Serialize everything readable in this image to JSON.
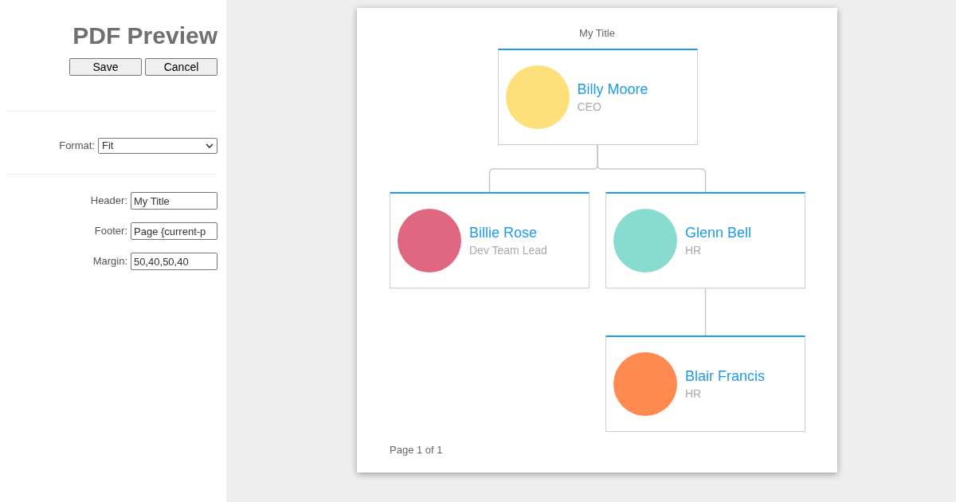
{
  "sidebar": {
    "title": "PDF Preview",
    "buttons": [
      "Save",
      "Cancel"
    ],
    "format": {
      "label": "Format:",
      "value": "Fit"
    },
    "fields": [
      {
        "label": "Header:",
        "value": "My Title"
      },
      {
        "label": "Footer:",
        "value": "Page {current-p"
      },
      {
        "label": "Margin:",
        "value": "50,40,50,40"
      }
    ]
  },
  "page": {
    "header": "My Title",
    "footer": "Page 1 of 1",
    "org_chart": {
      "name": "Billy Moore",
      "title": "CEO",
      "color": "#fde07a",
      "children": [
        {
          "name": "Billie Rose",
          "title": "Dev Team Lead",
          "color": "#df6780"
        },
        {
          "name": "Glenn Bell",
          "title": "HR",
          "color": "#87dccf",
          "children": [
            {
              "name": "Blair Francis",
              "title": "HR",
              "color": "#ff8a50"
            }
          ]
        }
      ]
    }
  }
}
